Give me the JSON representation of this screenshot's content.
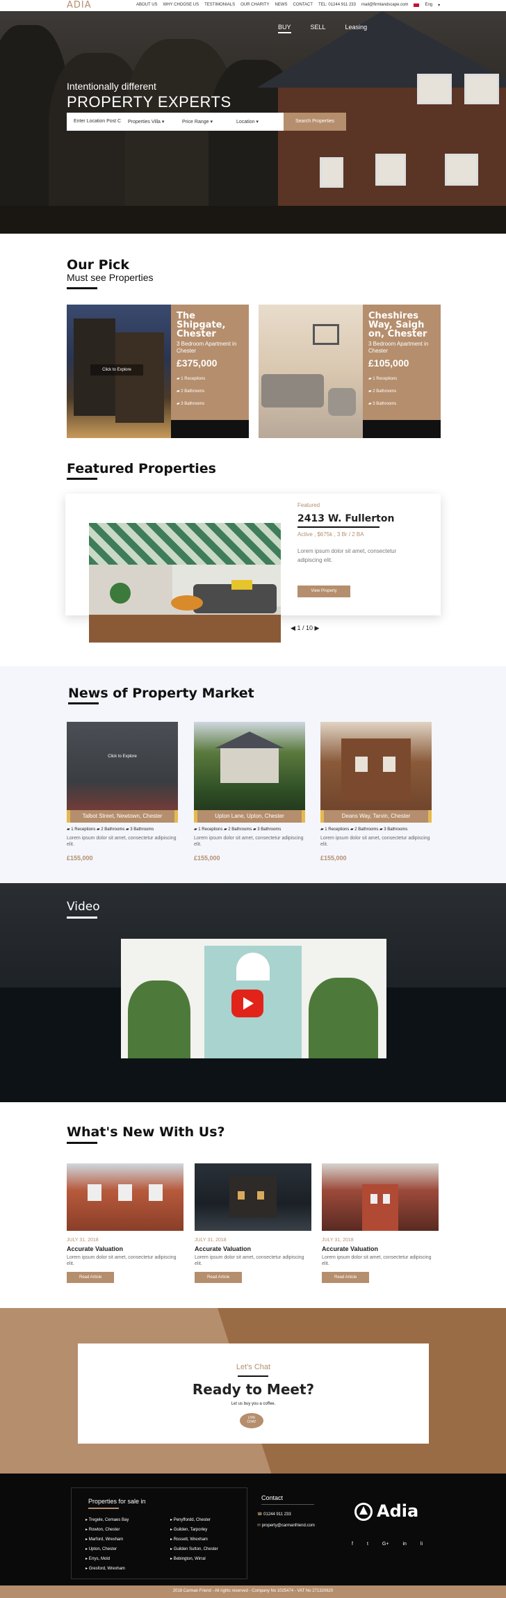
{
  "topbar": {
    "logo": "ADIA",
    "nav": [
      "ABOUT US",
      "WHY CHOOSE US",
      "TESTIMONIALS",
      "OUR CHARITY",
      "NEWS",
      "CONTACT",
      "TEL: 01244 911 233",
      "mail@firmlandscape.com"
    ],
    "lang": "Eng"
  },
  "hero": {
    "tabs": [
      "BUY",
      "SELL",
      "Leasing"
    ],
    "subtitle": "Intentionally different",
    "title": "PROPERTY EXPERTS",
    "search": {
      "location_placeholder": "Enter Location Post Code",
      "type": "Properties Villa",
      "price": "Price Range",
      "location": "Location",
      "button": "Search Properties"
    }
  },
  "pick": {
    "title": "Our Pick",
    "subtitle": "Must see Properties",
    "cards": [
      {
        "name": "The Shipgate, Chester",
        "desc": "3 Bedroom Apartment in Chester",
        "price": "£375,000",
        "features": [
          "1 Receptions",
          "2 Bathrooms",
          "3 Bathrooms"
        ],
        "overlay": "Click to Explore"
      },
      {
        "name": "Cheshires Way, Saigh on, Chester",
        "desc": "3 Bedroom Apartment in Chester",
        "price": "£105,000",
        "features": [
          "1 Receptions",
          "2 Bathrooms",
          "3 Bathrooms"
        ]
      }
    ]
  },
  "featured": {
    "title": "Featured Properties",
    "tag": "Featured",
    "address": "2413 W. Fullerton",
    "meta": "Active , $675k , 3 Br / 2 BA",
    "desc": "Lorem ipsum dolor sit amet, consectetur adipiscing elit.",
    "button": "View Property",
    "pager": "1 / 10"
  },
  "news": {
    "title": "News of Property Market",
    "overlay": "Click to Explore",
    "cards": [
      {
        "caption": "Talbot Street, Newtown, Chester",
        "meta": [
          "1 Receptions",
          "2 Bathrooms",
          "3 Bathrooms"
        ],
        "desc": "Lorem ipsum dolor sit amet, consectetur adipiscing elit.",
        "price": "£155,000"
      },
      {
        "caption": "Upton Lane, Upton, Chester",
        "meta": [
          "1 Receptions",
          "2 Bathrooms",
          "3 Bathrooms"
        ],
        "desc": "Lorem ipsum dolor sit amet, consectetur adipiscing elit.",
        "price": "£155,000"
      },
      {
        "caption": "Deans Way, Tarvin, Chester",
        "meta": [
          "1 Receptions",
          "2 Bathrooms",
          "3 Bathrooms"
        ],
        "desc": "Lorem ipsum dolor sit amet, consectetur adipiscing elit.",
        "price": "£155,000"
      }
    ]
  },
  "video": {
    "title": "Video"
  },
  "whatsnew": {
    "title": "What's New With Us?",
    "cards": [
      {
        "date": "JULY 31, 2018",
        "title": "Accurate Valuation",
        "desc": "Lorem ipsum dolor sit amet, consectetur adipiscing elit.",
        "button": "Read Article"
      },
      {
        "date": "JULY 31, 2018",
        "title": "Accurate Valuation",
        "desc": "Lorem ipsum dolor sit amet, consectetur adipiscing elit.",
        "button": "Read Article"
      },
      {
        "date": "JULY 31, 2018",
        "title": "Accurate Valuation",
        "desc": "Lorem ipsum dolor sit amet, consectetur adipiscing elit.",
        "button": "Read Article"
      }
    ]
  },
  "chat": {
    "kicker": "Let's Chat",
    "title": "Ready to Meet?",
    "sub": "Let us buy you a coffee.",
    "badge1": "LIVE",
    "badge2": "CHAT"
  },
  "footer": {
    "props_title": "Properties for sale in",
    "col1": [
      "Tregele, Cemaes Bay",
      "Rowton, Chester",
      "Marford, Wrexham",
      "Upton, Chester",
      "Errys, Mold",
      "Gresford, Wrexham"
    ],
    "col2": [
      "Penyffordd, Chester",
      "Guilden, Tarporley",
      "Rossett, Wrexham",
      "Guilden Sutton, Chester",
      "Bebington, Wirral"
    ],
    "contact_title": "Contact",
    "phone": "01244 911 233",
    "email": "property@carmanfriend.com",
    "brand": "Adia",
    "social": [
      "f",
      "t",
      "G+",
      "in",
      "li"
    ],
    "copyright": "2018 Carman Friend - All rights reserved - Company No 1025474 - VAT No 271320620"
  },
  "colors": {
    "accent": "#b58e6d",
    "dark": "#111111",
    "highlight": "#e6b94d"
  }
}
